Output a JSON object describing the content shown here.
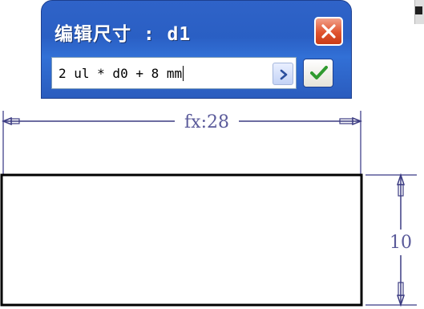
{
  "dialog": {
    "title": "编辑尺寸 : d1",
    "expression": "2 ul * d0 + 8 mm"
  },
  "drawing": {
    "horizontal_dimension": "fx:28",
    "vertical_dimension": "10"
  },
  "colors": {
    "dialog_blue": "#2a5fc4",
    "close_red": "#e0542f",
    "accept_green": "#2f9a2f",
    "dimension_color": "#5a5a9a"
  },
  "icons": {
    "close": "close-icon",
    "dropdown": "chevron-right-icon",
    "accept": "checkmark-icon"
  }
}
